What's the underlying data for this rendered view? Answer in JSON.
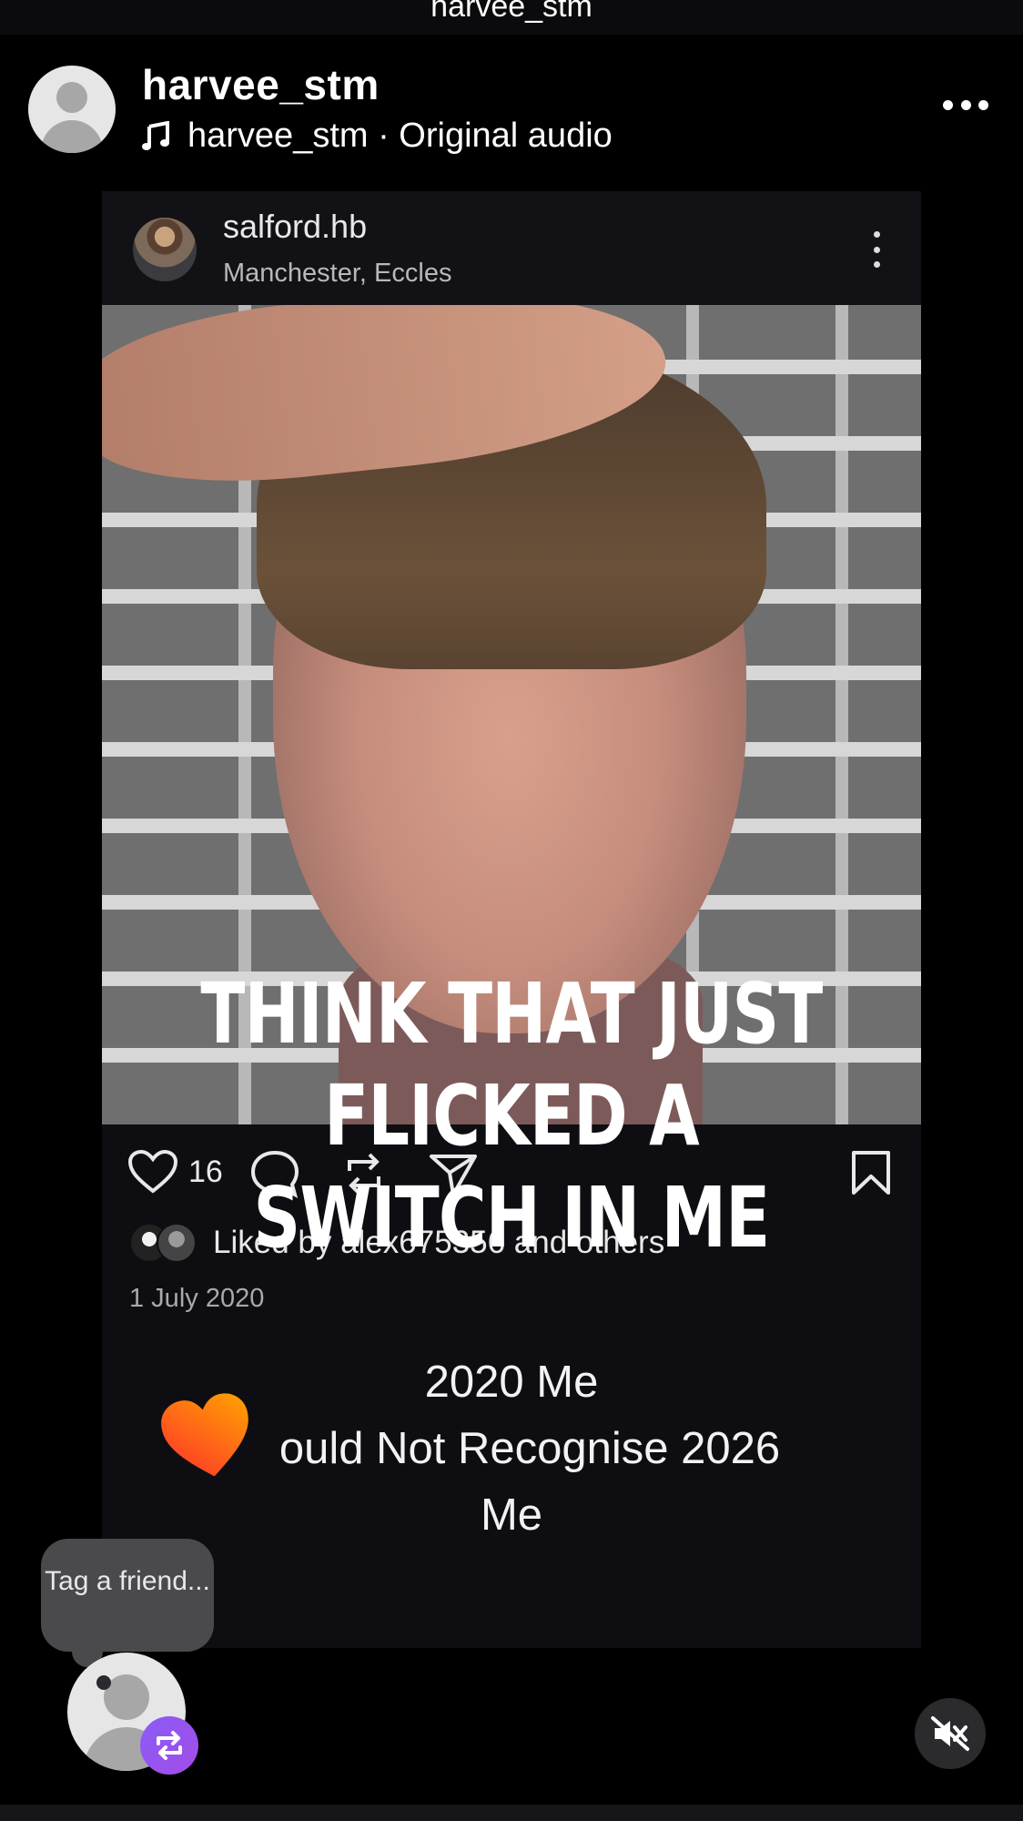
{
  "topbar": {
    "title": "harvee_stm"
  },
  "header": {
    "username": "harvee_stm",
    "audio_label": "harvee_stm · Original audio",
    "icons": {
      "audio": "music-note-icon",
      "more": "more-horizontal-icon"
    }
  },
  "post": {
    "username": "salford.hb",
    "location": "Manchester, Eccles",
    "likes": "16",
    "liked_by": "Liked by alex675356 and others",
    "date": "1 July 2020",
    "icons": [
      "heart-icon",
      "comment-icon",
      "repost-icon",
      "share-icon",
      "bookmark-icon"
    ]
  },
  "overlay": {
    "line1": "THINK THAT JUST FLICKED A",
    "line2": "SWITCH IN ME"
  },
  "caption": {
    "line1": "2020 Me",
    "line2": "ould Not Recognise 2026",
    "line3": "Me"
  },
  "tooltip": {
    "text": "Tag a friend..."
  },
  "colors": {
    "badge": "#9b51e0",
    "heart_start": "#ff3b30",
    "heart_end": "#ff9f0a"
  }
}
